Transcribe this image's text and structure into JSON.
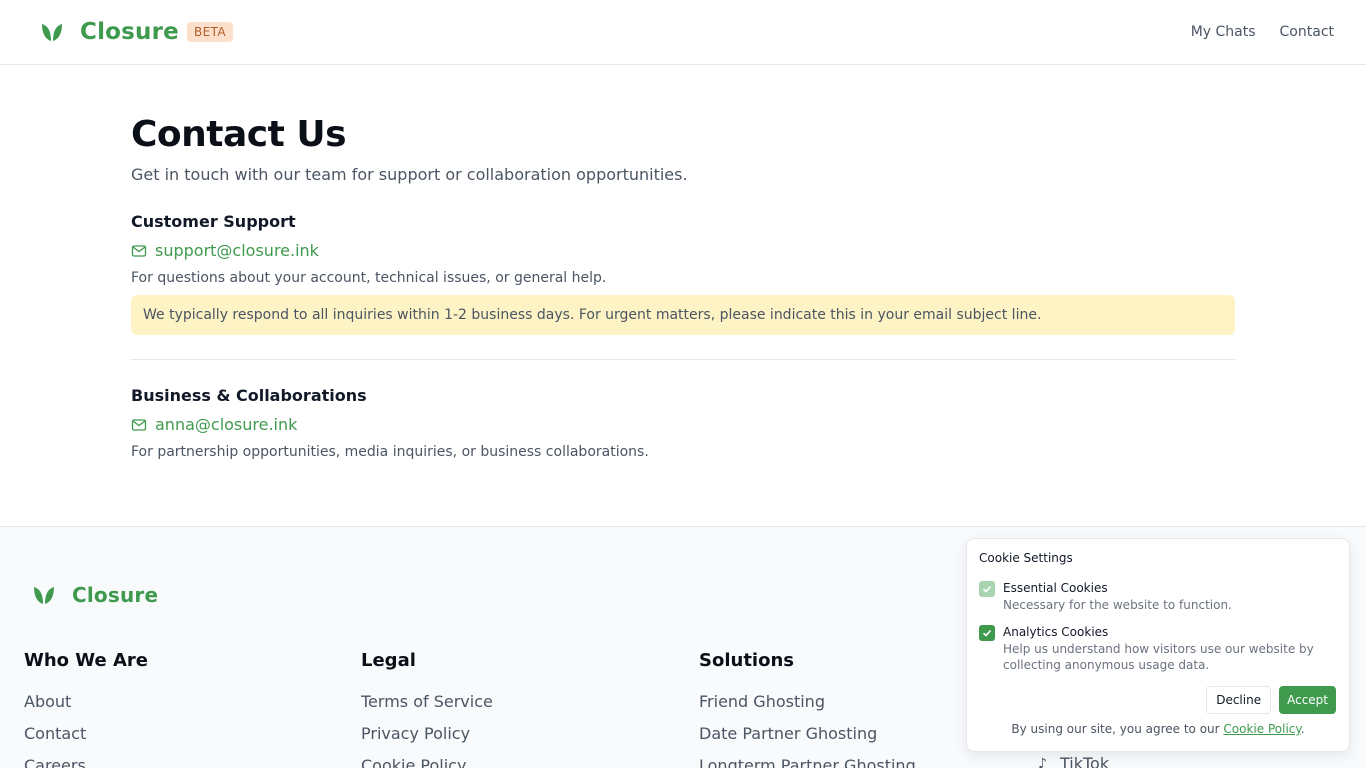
{
  "header": {
    "brand": "Closure",
    "badge": "BETA",
    "nav": [
      "My Chats",
      "Contact"
    ]
  },
  "main": {
    "title": "Contact Us",
    "subtitle": "Get in touch with our team for support or collaboration opportunities.",
    "support": {
      "title": "Customer Support",
      "email": "support@closure.ink",
      "desc": "For questions about your account, technical issues, or general help.",
      "note": "We typically respond to all inquiries within 1-2 business days. For urgent matters, please indicate this in your email subject line."
    },
    "business": {
      "title": "Business & Collaborations",
      "email": "anna@closure.ink",
      "desc": "For partnership opportunities, media inquiries, or business collaborations."
    }
  },
  "footer": {
    "brand": "Closure",
    "columns": [
      {
        "title": "Who We Are",
        "links": [
          "About",
          "Contact",
          "Careers"
        ]
      },
      {
        "title": "Legal",
        "links": [
          "Terms of Service",
          "Privacy Policy",
          "Cookie Policy"
        ]
      },
      {
        "title": "Solutions",
        "links": [
          "Friend Ghosting",
          "Date Partner Ghosting",
          "Longterm Partner Ghosting"
        ]
      }
    ],
    "partial_link": "TikTok"
  },
  "cookie": {
    "title": "Cookie Settings",
    "essential_label": "Essential Cookies",
    "essential_desc": "Necessary for the website to function.",
    "analytics_label": "Analytics Cookies",
    "analytics_desc": "Help us understand how visitors use our website by collecting anonymous usage data.",
    "decline": "Decline",
    "accept": "Accept",
    "foot_prefix": "By using our site, you agree to our",
    "foot_link": "Cookie Policy",
    "foot_suffix": "."
  },
  "colors": {
    "brand_green": "#3f9a4e",
    "note_bg": "#fdf3c4",
    "badge_bg": "#fde0cc"
  }
}
